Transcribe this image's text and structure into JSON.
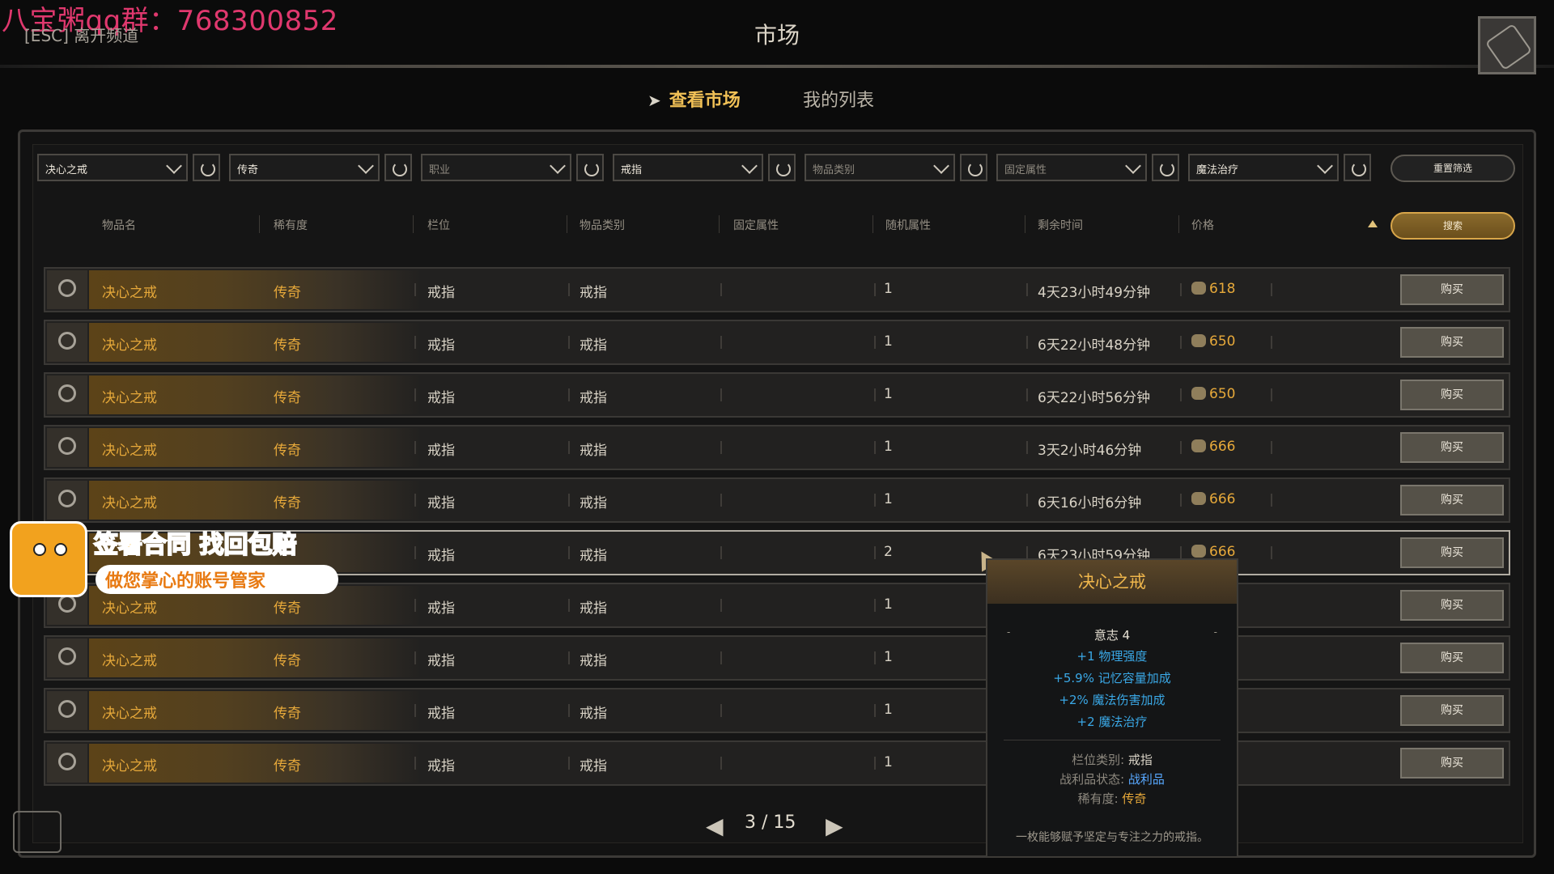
{
  "overlay": {
    "watermark": "八宝粥qq群：768300852",
    "promo_line1": "签署合同 找回包赔",
    "promo_line2": "做您掌心的账号管家"
  },
  "header": {
    "esc_hint": "[ESC] 离开频道",
    "title": "市场"
  },
  "tabs": [
    {
      "label": "查看市场",
      "active": true
    },
    {
      "label": "我的列表",
      "active": false
    }
  ],
  "filters": [
    {
      "label": "决心之戒",
      "is_placeholder": false
    },
    {
      "label": "传奇",
      "is_placeholder": false
    },
    {
      "label": "职业",
      "is_placeholder": true
    },
    {
      "label": "戒指",
      "is_placeholder": false
    },
    {
      "label": "物品类别",
      "is_placeholder": true
    },
    {
      "label": "固定属性",
      "is_placeholder": true
    },
    {
      "label": "魔法治疗",
      "is_placeholder": false
    }
  ],
  "reset_label": "重置筛选",
  "search_label": "搜索",
  "columns": [
    "物品名",
    "稀有度",
    "栏位",
    "物品类别",
    "固定属性",
    "随机属性",
    "剩余时间",
    "价格"
  ],
  "rows": [
    {
      "name": "决心之戒",
      "rarity": "传奇",
      "slot": "戒指",
      "category": "戒指",
      "random": "1",
      "time": "4天23小时49分钟",
      "price": "618",
      "buy": "购买"
    },
    {
      "name": "决心之戒",
      "rarity": "传奇",
      "slot": "戒指",
      "category": "戒指",
      "random": "1",
      "time": "6天22小时48分钟",
      "price": "650",
      "buy": "购买"
    },
    {
      "name": "决心之戒",
      "rarity": "传奇",
      "slot": "戒指",
      "category": "戒指",
      "random": "1",
      "time": "6天22小时56分钟",
      "price": "650",
      "buy": "购买"
    },
    {
      "name": "决心之戒",
      "rarity": "传奇",
      "slot": "戒指",
      "category": "戒指",
      "random": "1",
      "time": "3天2小时46分钟",
      "price": "666",
      "buy": "购买"
    },
    {
      "name": "决心之戒",
      "rarity": "传奇",
      "slot": "戒指",
      "category": "戒指",
      "random": "1",
      "time": "6天16小时6分钟",
      "price": "666",
      "buy": "购买"
    },
    {
      "name": "",
      "rarity": "",
      "slot": "戒指",
      "category": "戒指",
      "random": "2",
      "time": "6天23小时59分钟",
      "price": "666",
      "buy": "购买"
    },
    {
      "name": "决心之戒",
      "rarity": "传奇",
      "slot": "戒指",
      "category": "戒指",
      "random": "1",
      "time": "",
      "price": "",
      "buy": "购买"
    },
    {
      "name": "决心之戒",
      "rarity": "传奇",
      "slot": "戒指",
      "category": "戒指",
      "random": "1",
      "time": "",
      "price": "",
      "buy": "购买"
    },
    {
      "name": "决心之戒",
      "rarity": "传奇",
      "slot": "戒指",
      "category": "戒指",
      "random": "1",
      "time": "",
      "price": "",
      "buy": "购买"
    },
    {
      "name": "决心之戒",
      "rarity": "传奇",
      "slot": "戒指",
      "category": "戒指",
      "random": "1",
      "time": "",
      "price": "",
      "buy": "购买"
    }
  ],
  "pagination": {
    "text": "3 / 15"
  },
  "tooltip": {
    "title": "决心之戒",
    "base_stat": "意志 4",
    "bonus_stats": [
      "+1 物理强度",
      "+5.9% 记忆容量加成",
      "+2% 魔法伤害加成",
      "+2 魔法治疗"
    ],
    "slot_label": "栏位类别:",
    "slot_value": "戒指",
    "loot_label": "战利品状态:",
    "loot_value": "战利品",
    "rarity_label": "稀有度:",
    "rarity_value": "传奇",
    "description": "一枚能够赋予坚定与专注之力的戒指。"
  },
  "colors": {
    "legendary": "#e7a93a",
    "bonus_stat": "#3aa8e6",
    "loot": "#58a8ff",
    "watermark": "#e0386e"
  },
  "icons": [
    "ring-icon",
    "coin-icon",
    "refresh-icon",
    "chevron-down-icon",
    "arrow-left-icon",
    "arrow-right-icon",
    "sort-asc-icon"
  ]
}
